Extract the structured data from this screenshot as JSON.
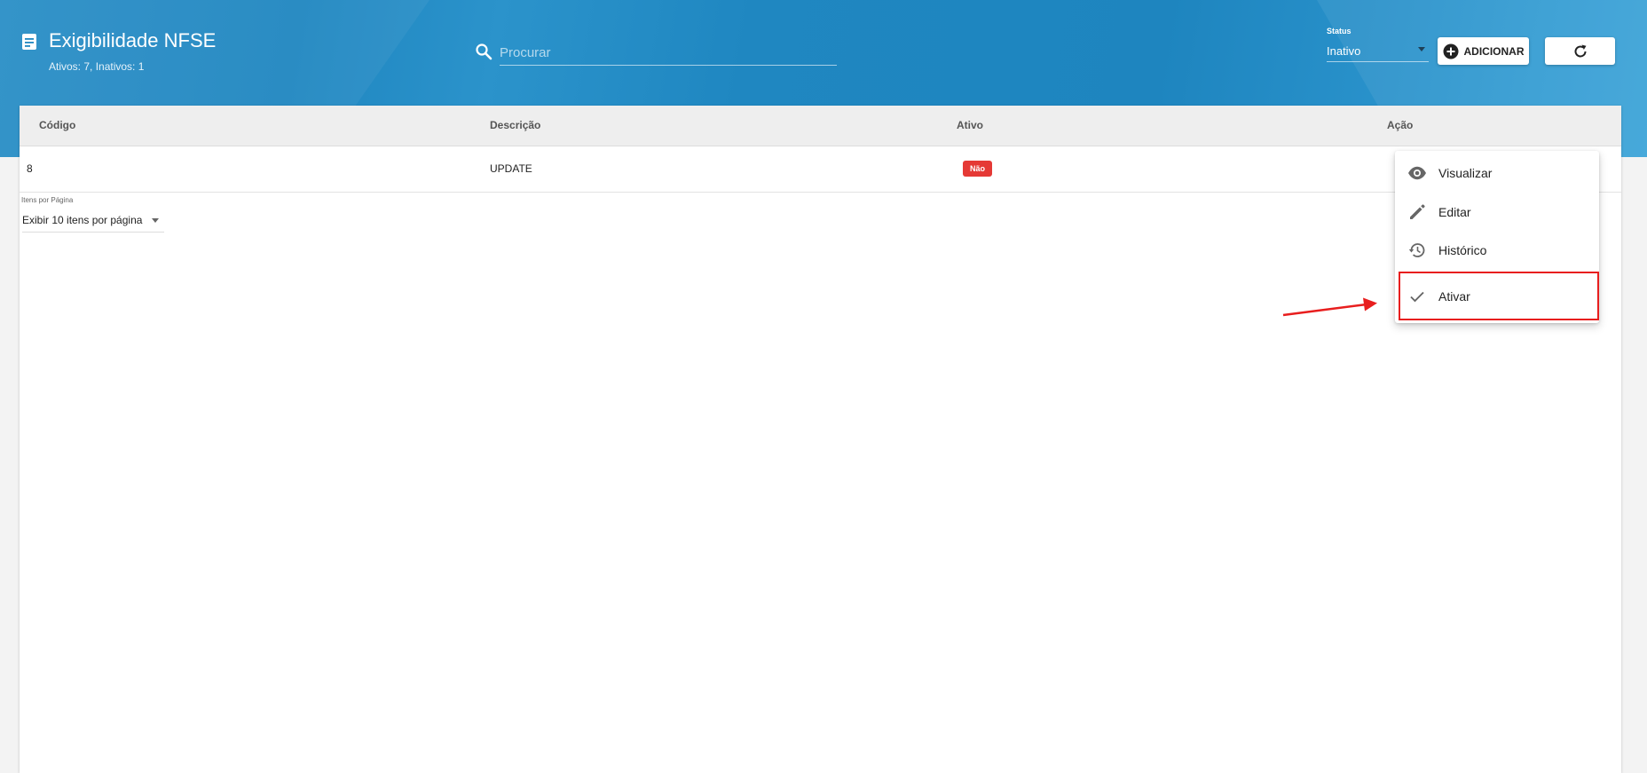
{
  "header": {
    "title": "Exigibilidade NFSE",
    "subtitle": "Ativos: 7, Inativos: 1",
    "search": {
      "placeholder": "Procurar",
      "value": ""
    },
    "status_filter": {
      "label": "Status",
      "value": "Inativo"
    },
    "add_button_label": "ADICIONAR"
  },
  "table": {
    "columns": [
      "Código",
      "Descrição",
      "Ativo",
      "Ação"
    ],
    "rows": [
      {
        "codigo": "8",
        "descricao": "UPDATE",
        "ativo": "Não"
      }
    ]
  },
  "pagination": {
    "label": "Itens por Página",
    "value": "Exibir 10 itens por página"
  },
  "action_menu": {
    "items": [
      {
        "label": "Visualizar",
        "icon": "eye-icon"
      },
      {
        "label": "Editar",
        "icon": "pencil-icon"
      },
      {
        "label": "Histórico",
        "icon": "history-icon"
      },
      {
        "label": "Ativar",
        "icon": "check-icon"
      }
    ]
  },
  "colors": {
    "header_blue": "#1f86c0",
    "badge_red": "#e53935",
    "annotation_red": "#e81e1e"
  }
}
